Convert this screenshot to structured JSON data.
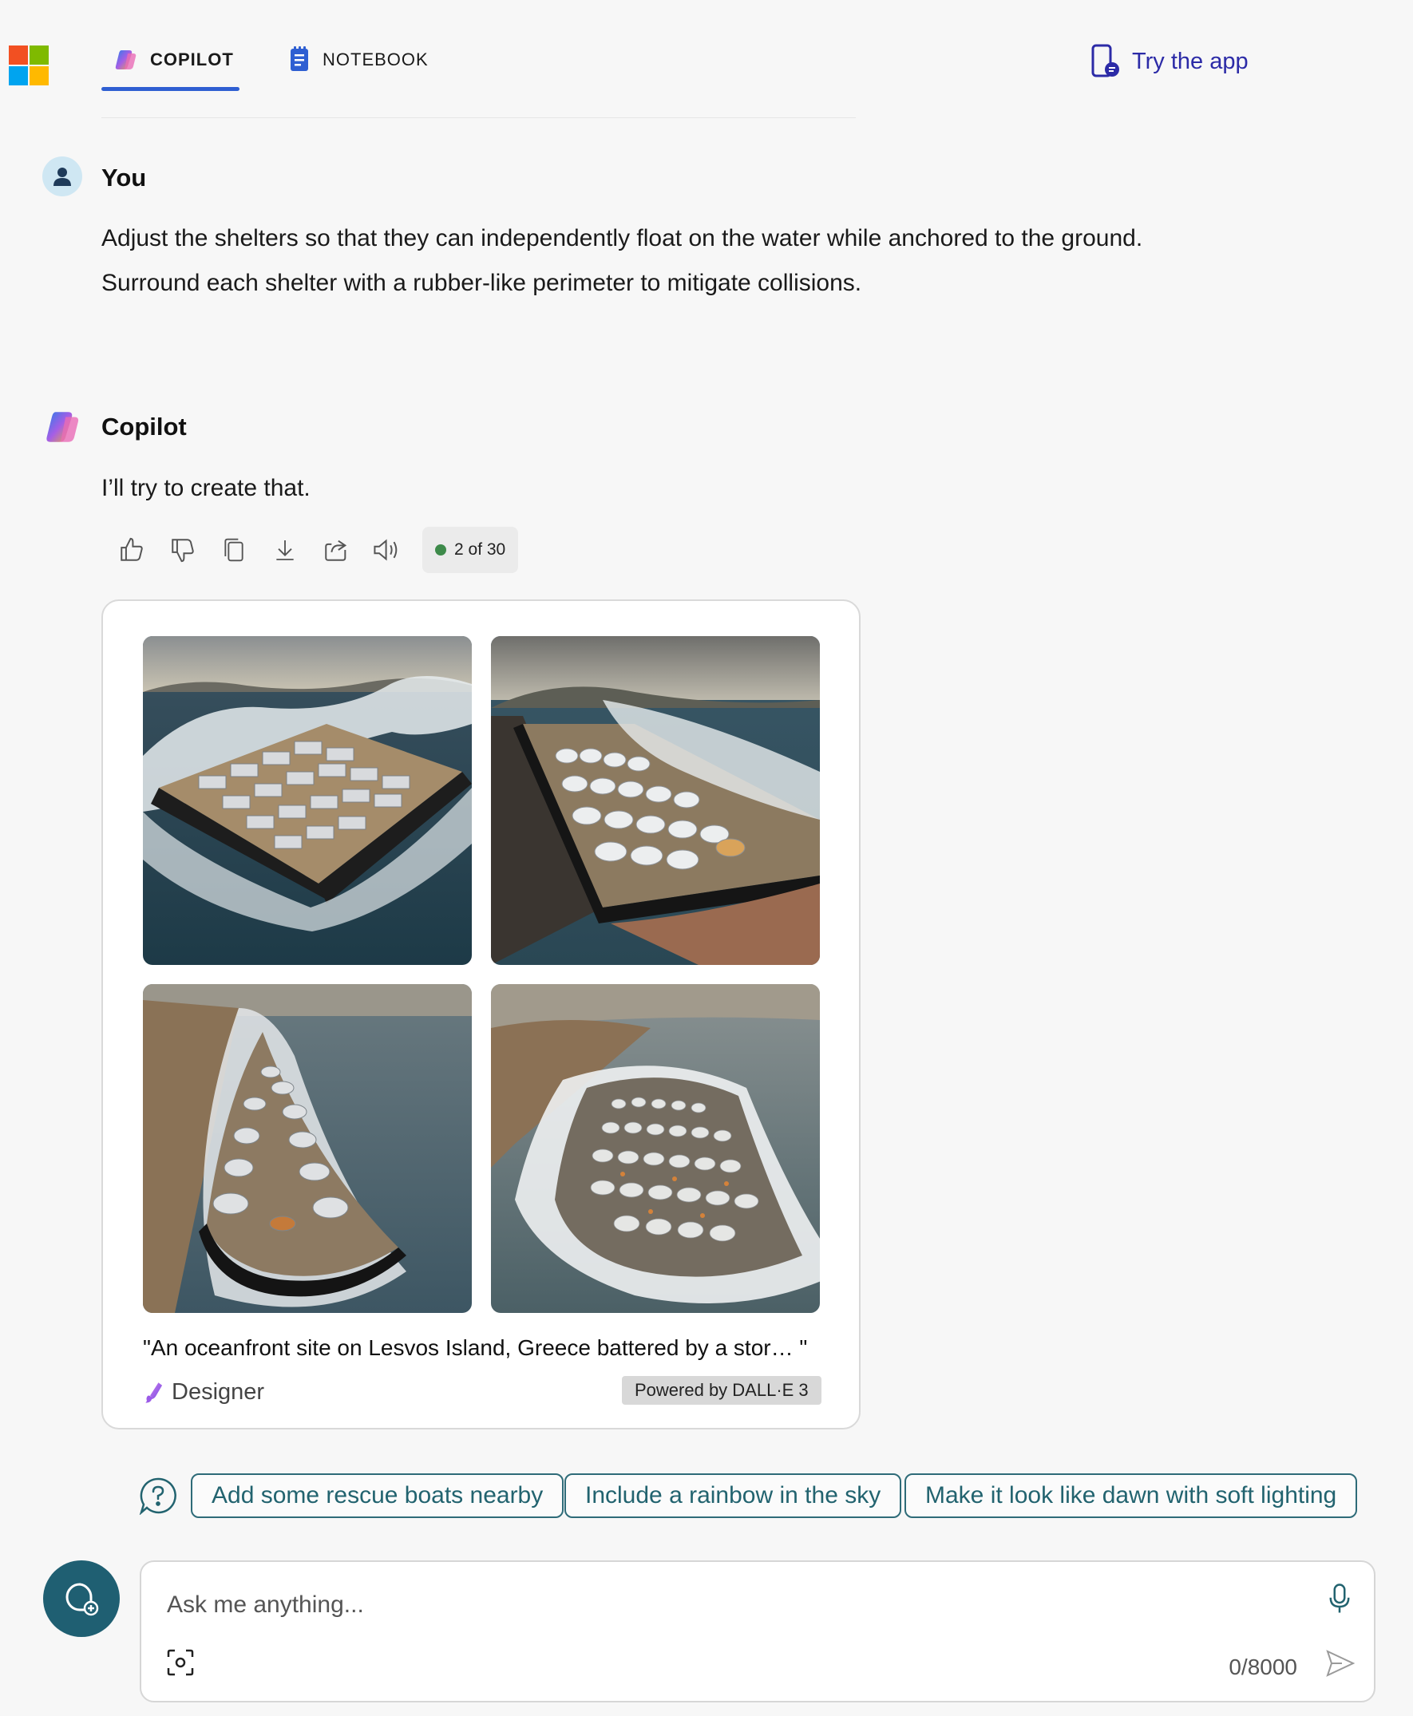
{
  "header": {
    "tabs": [
      {
        "label": "COPILOT",
        "active": true
      },
      {
        "label": "NOTEBOOK",
        "active": false
      }
    ],
    "try_app_label": "Try the app"
  },
  "conversation": {
    "user": {
      "name": "You",
      "lines": [
        "Adjust the shelters so that they can independently float on the water while anchored to the ground.",
        "Surround each shelter with a rubber-like perimeter to mitigate collisions."
      ]
    },
    "assistant": {
      "name": "Copilot",
      "reply": "I’ll try to create that.",
      "counter": "2 of 30"
    }
  },
  "image_card": {
    "caption": "\"An oceanfront site on Lesvos Island, Greece battered by a stor…   \"",
    "brand": "Designer",
    "powered_by": "Powered by DALL·E 3"
  },
  "suggestions": [
    "Add some rescue boats nearby",
    "Include a rainbow in the sky",
    "Make it look like dawn with soft lighting"
  ],
  "composer": {
    "placeholder": "Ask me anything...",
    "char_count": "0/8000"
  },
  "icons": {
    "toolbar": [
      "thumbs-up-icon",
      "thumbs-down-icon",
      "copy-icon",
      "download-icon",
      "share-icon",
      "read-aloud-icon"
    ]
  },
  "colors": {
    "accent_blue": "#2f5fd2",
    "chip_teal": "#22636f",
    "new_topic_bg": "#1f5f72",
    "try_app": "#2c2ba7"
  }
}
